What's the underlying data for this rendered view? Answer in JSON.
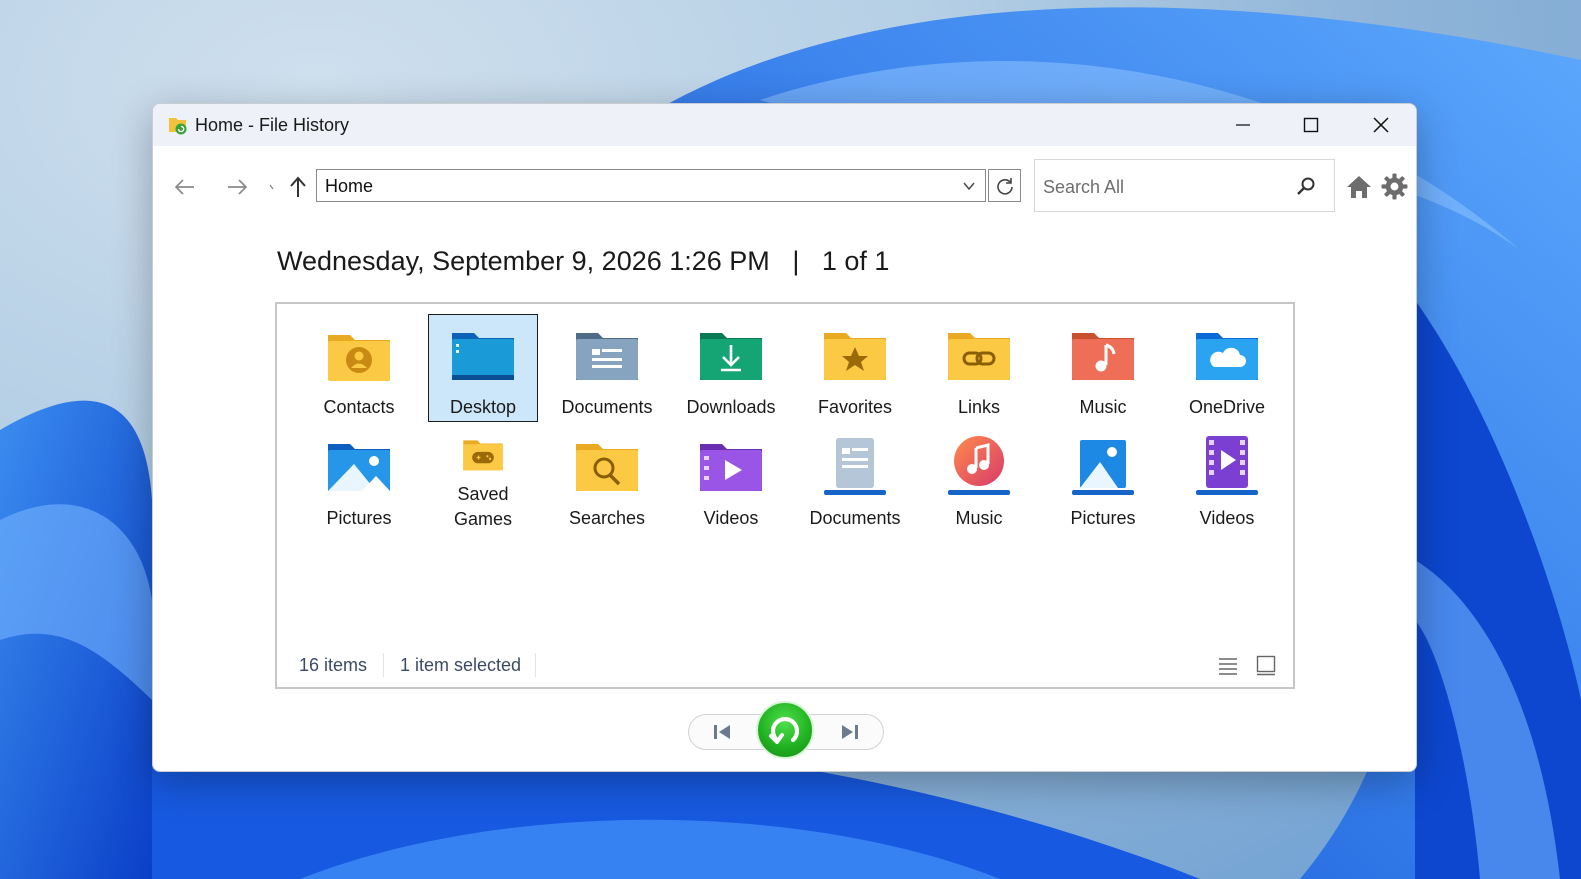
{
  "window": {
    "title": "Home - File History",
    "controls": {
      "minimize": "minimize",
      "maximize": "maximize",
      "close": "close"
    }
  },
  "toolbar": {
    "address": "Home",
    "search_placeholder": "Search All"
  },
  "snapshot": {
    "datetime": "Wednesday, September 9, 2026 1:26 PM",
    "separator": "|",
    "position": "1 of 1"
  },
  "items": [
    {
      "label": "Contacts",
      "icon": "contacts-folder-icon",
      "selected": false
    },
    {
      "label": "Desktop",
      "icon": "desktop-folder-icon",
      "selected": true
    },
    {
      "label": "Documents",
      "icon": "documents-folder-icon",
      "selected": false
    },
    {
      "label": "Downloads",
      "icon": "downloads-folder-icon",
      "selected": false
    },
    {
      "label": "Favorites",
      "icon": "favorites-folder-icon",
      "selected": false
    },
    {
      "label": "Links",
      "icon": "links-folder-icon",
      "selected": false
    },
    {
      "label": "Music",
      "icon": "music-folder-icon",
      "selected": false
    },
    {
      "label": "OneDrive",
      "icon": "onedrive-folder-icon",
      "selected": false
    },
    {
      "label": "Pictures",
      "icon": "pictures-folder-icon",
      "selected": false
    },
    {
      "label": "Saved Games",
      "icon": "saved-games-folder-icon",
      "selected": false
    },
    {
      "label": "Searches",
      "icon": "searches-folder-icon",
      "selected": false
    },
    {
      "label": "Videos",
      "icon": "videos-folder-icon",
      "selected": false
    },
    {
      "label": "Documents",
      "icon": "documents-library-icon",
      "selected": false
    },
    {
      "label": "Music",
      "icon": "music-library-icon",
      "selected": false
    },
    {
      "label": "Pictures",
      "icon": "pictures-library-icon",
      "selected": false
    },
    {
      "label": "Videos",
      "icon": "videos-library-icon",
      "selected": false
    }
  ],
  "status": {
    "item_count": "16 items",
    "selection": "1 item selected"
  },
  "colors": {
    "accent_green": "#22b322",
    "selection_bg": "#cce6fa",
    "status_text": "#3b4a66"
  }
}
